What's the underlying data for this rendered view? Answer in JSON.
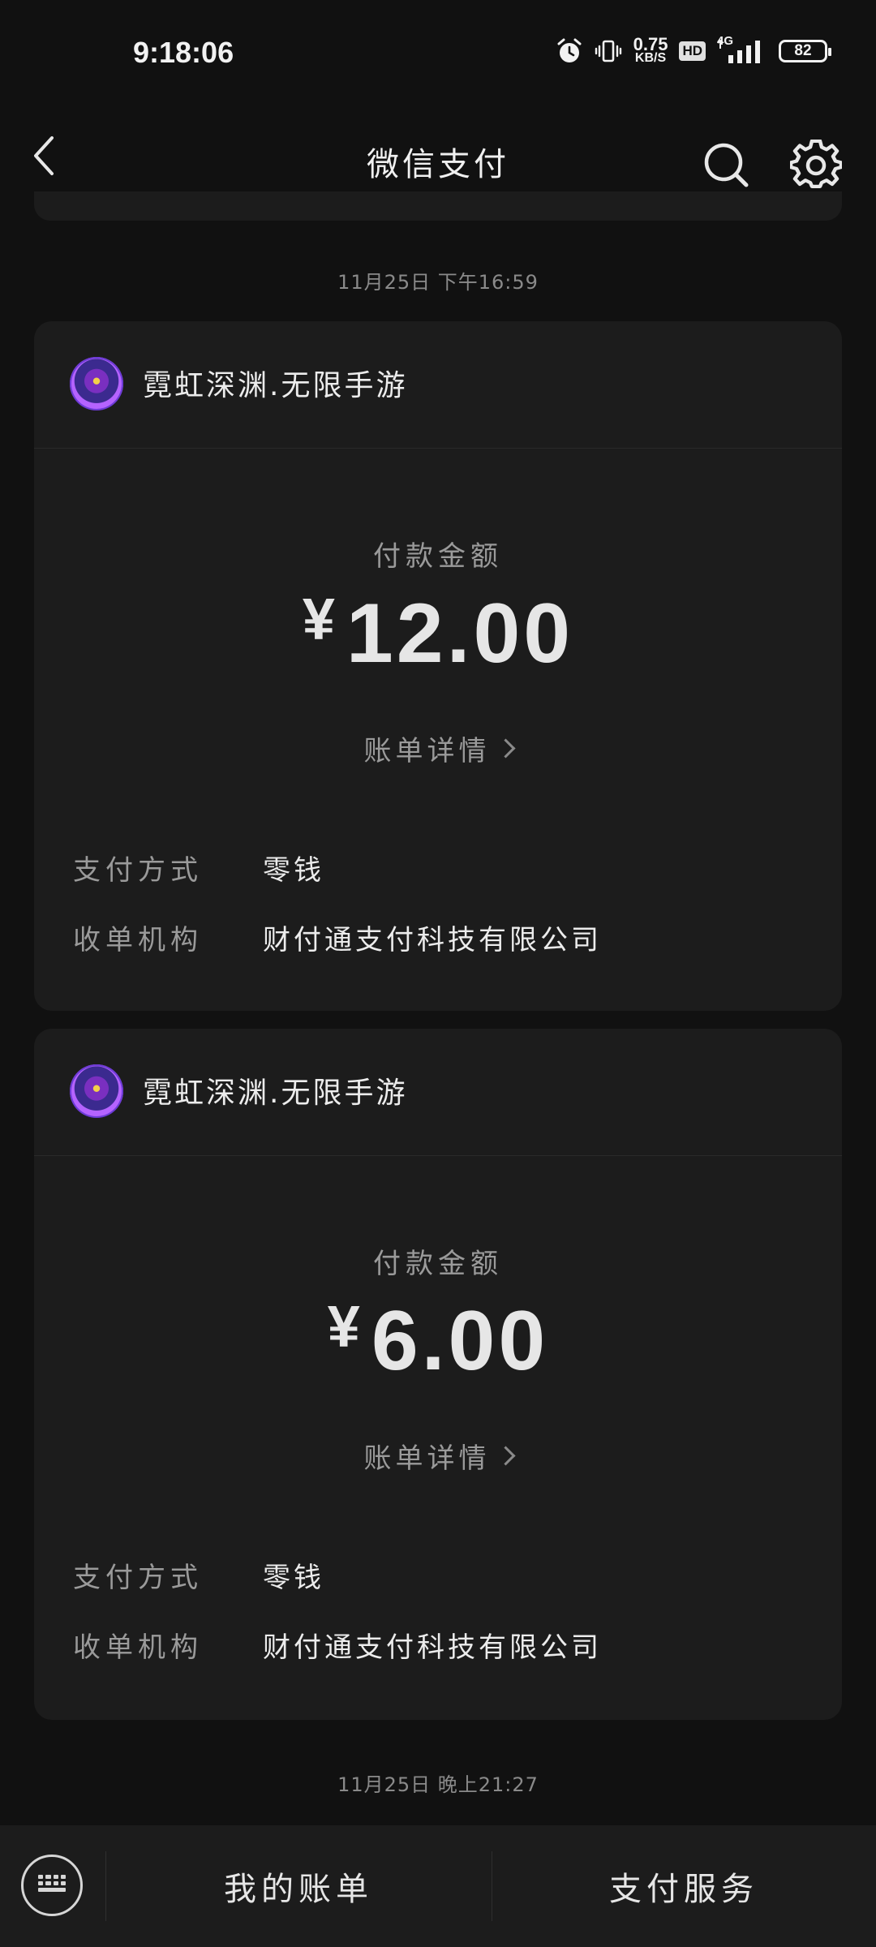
{
  "status_bar": {
    "time": "9:18:06",
    "net_speed_value": "0.75",
    "net_speed_unit": "KB/S",
    "hd_label": "HD",
    "network_label": "4G",
    "battery_level": "82",
    "icons": [
      "alarm-icon",
      "vibrate-icon",
      "signal-icon"
    ]
  },
  "nav": {
    "title": "微信支付",
    "back_icon": "back-icon",
    "search_icon": "search-icon",
    "settings_icon": "settings-icon"
  },
  "messages": [
    {
      "date": "11月25日 下午16:59",
      "merchant": "霓虹深渊.无限手游",
      "amount_label": "付款金额",
      "currency": "¥",
      "amount": "12.00",
      "detail_link": "账单详情",
      "rows": [
        {
          "key": "支付方式",
          "value": "零钱"
        },
        {
          "key": "收单机构",
          "value": "财付通支付科技有限公司"
        }
      ]
    },
    {
      "merchant": "霓虹深渊.无限手游",
      "amount_label": "付款金额",
      "currency": "¥",
      "amount": "6.00",
      "detail_link": "账单详情",
      "rows": [
        {
          "key": "支付方式",
          "value": "零钱"
        },
        {
          "key": "收单机构",
          "value": "财付通支付科技有限公司"
        }
      ]
    }
  ],
  "next_date": "11月25日 晚上21:27",
  "bottom_bar": {
    "keyboard_icon": "keyboard-icon",
    "tabs": [
      {
        "label": "我的账单"
      },
      {
        "label": "支付服务"
      }
    ]
  }
}
